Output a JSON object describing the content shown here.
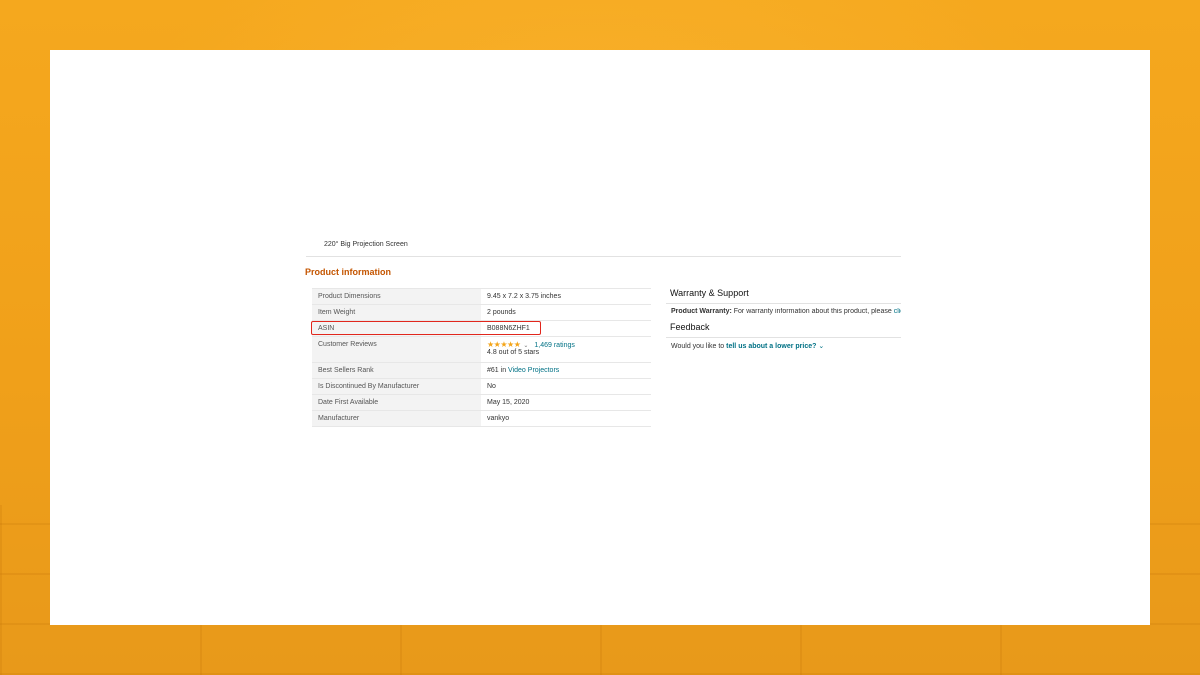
{
  "caption": "220° Big Projection Screen",
  "section_title": "Product information",
  "specs": [
    {
      "label": "Product Dimensions",
      "value": "9.45 x 7.2 x 3.75 inches"
    },
    {
      "label": "Item Weight",
      "value": "2 pounds"
    },
    {
      "label": "ASIN",
      "value": "B088N6ZHF1"
    },
    {
      "label": "Customer Reviews",
      "stars": "★★★★★",
      "star_rating": 4.8,
      "ratings": "1,469 ratings",
      "rating_text": "4.8 out of 5 stars"
    },
    {
      "label": "Best Sellers Rank",
      "rank": "#61",
      "rank_in": "in",
      "category": "Video Projectors"
    },
    {
      "label": "Is Discontinued By Manufacturer",
      "value": "No"
    },
    {
      "label": "Date First Available",
      "value": "May 15, 2020"
    },
    {
      "label": "Manufacturer",
      "value": "vankyo"
    }
  ],
  "warranty": {
    "title": "Warranty & Support",
    "label": "Product Warranty:",
    "text": "For warranty information about this product, please",
    "link": "clic"
  },
  "feedback": {
    "title": "Feedback",
    "prefix": "Would you like to",
    "link": "tell us about a lower price?",
    "chevron": "⌄"
  },
  "colors": {
    "accent": "#c45500",
    "link": "#007185",
    "highlight": "#e1261c",
    "star": "#f4a417",
    "background": "#f2a21a"
  }
}
